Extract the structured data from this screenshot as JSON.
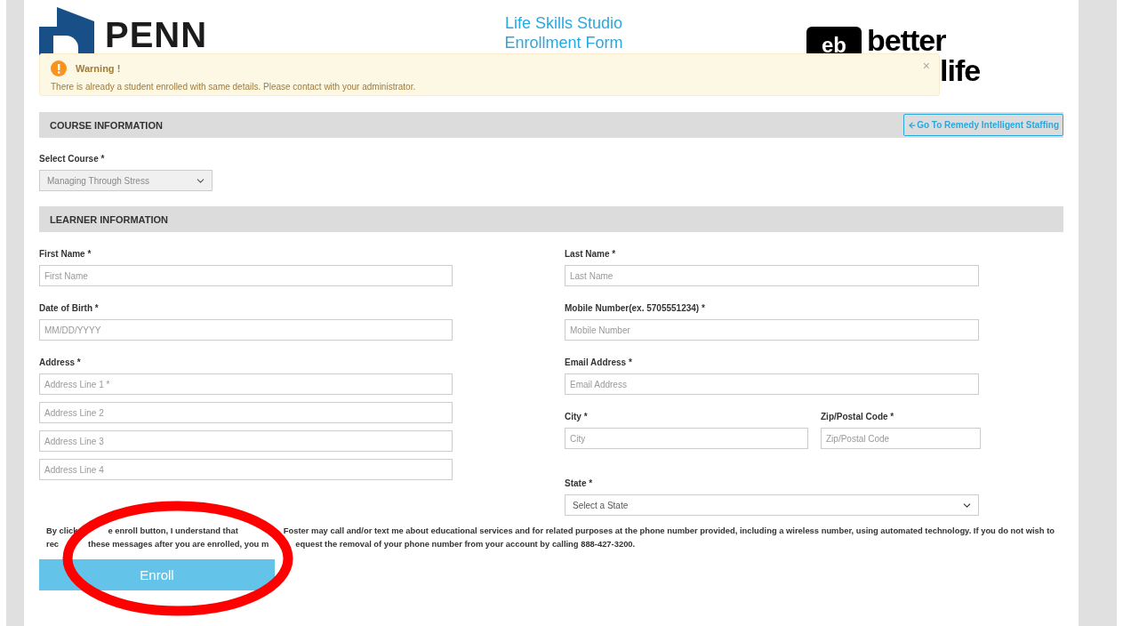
{
  "header": {
    "logo_left": {
      "text": "PENN"
    },
    "title": [
      "Life Skills Studio",
      "Enrollment Form"
    ],
    "logo_right": {
      "mark": "eb",
      "lines": [
        "better",
        "life"
      ]
    }
  },
  "alert": {
    "title": "Warning !",
    "message": "There is already a student enrolled with same details. Please contact with your administrator.",
    "close": "×"
  },
  "course": {
    "title": "COURSE INFORMATION",
    "link": "Go To Remedy Intelligent Staffing",
    "label": "Select Course *",
    "value": "Managing Through Stress",
    "disabled": true
  },
  "learner": {
    "title": "LEARNER INFORMATION",
    "left": [
      {
        "kind": "input",
        "label": "First Name *",
        "placeholders": [
          "First Name"
        ]
      },
      {
        "kind": "input",
        "label": "Date of Birth *",
        "placeholders": [
          "MM/DD/YYYY"
        ]
      },
      {
        "kind": "input",
        "label": "Address *",
        "placeholders": [
          "Address Line 1 *",
          "Address Line 2",
          "Address Line 3",
          "Address Line 4"
        ]
      }
    ],
    "right": [
      {
        "kind": "input",
        "label": "Last Name *",
        "placeholders": [
          "Last Name"
        ]
      },
      {
        "kind": "input",
        "label": "Mobile Number(ex. 5705551234) *",
        "placeholders": [
          "Mobile Number"
        ]
      },
      {
        "kind": "input",
        "label": "Email Address *",
        "placeholders": [
          "Email Address"
        ]
      },
      {
        "kind": "pair",
        "items": [
          {
            "label": "City *",
            "placeholder": "City"
          },
          {
            "label": "Zip/Postal Code *",
            "placeholder": "Zip/Postal Code"
          }
        ]
      },
      {
        "kind": "select",
        "label": "State *",
        "placeholders": [
          "Select a State"
        ]
      }
    ]
  },
  "disclaimer": [
    [
      "By click",
      "e enroll button, I understand that",
      "Foster may call and/or text me about educational services and for related purposes at the phone number provided, including a wireless number, using automated technology. If you do not wish to"
    ],
    [
      "rec",
      "these messages after you are enrolled, you m",
      "equest the removal of your phone number from your account by calling 888-427-3200."
    ]
  ],
  "enroll": "Enroll"
}
